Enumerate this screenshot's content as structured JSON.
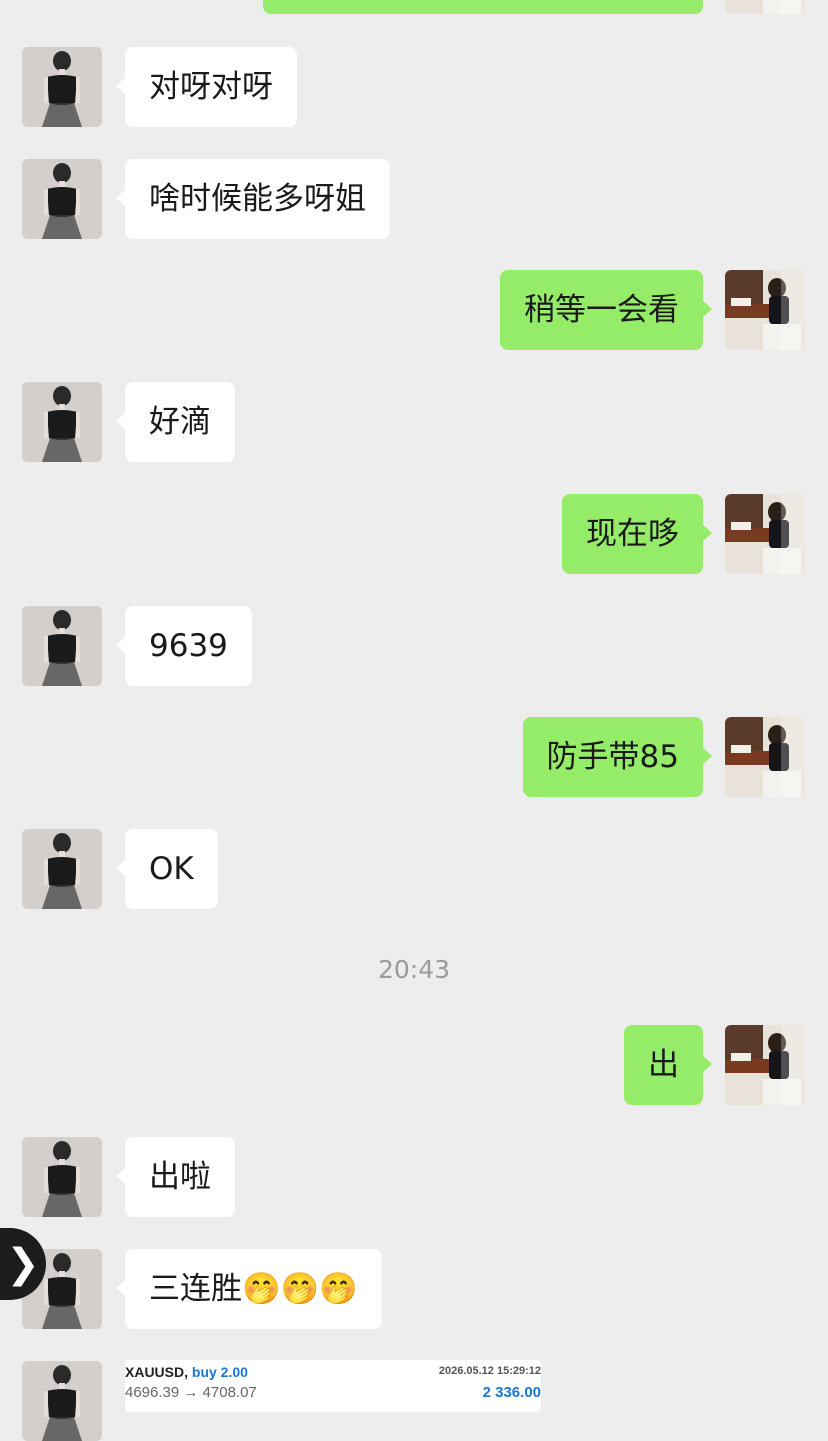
{
  "colors": {
    "background": "#ededed",
    "incoming_bubble": "#ffffff",
    "outgoing_bubble": "#95ec69",
    "timestamp": "#9a9a9a",
    "trade_accent": "#1976d2"
  },
  "messages": [
    {
      "sender": "contact",
      "text": "对呀对呀"
    },
    {
      "sender": "contact",
      "text": "啥时候能多呀姐"
    },
    {
      "sender": "me",
      "text": "稍等一会看"
    },
    {
      "sender": "contact",
      "text": "好滴"
    },
    {
      "sender": "me",
      "text": "现在哆"
    },
    {
      "sender": "contact",
      "text": "9639"
    },
    {
      "sender": "me",
      "text": "防手带85"
    },
    {
      "sender": "contact",
      "text": "OK"
    },
    {
      "sender": "me",
      "text": "出"
    },
    {
      "sender": "contact",
      "text": "出啦"
    },
    {
      "sender": "contact",
      "text": "三连胜🤭🤭🤭"
    }
  ],
  "timestamp": "20:43",
  "side_tab": {
    "icon": "chevron-right-icon",
    "glyph": "❯"
  },
  "trade_card": {
    "symbol": "XAUUSD,",
    "side": "buy 2.00",
    "datetime": "2026.05.12 15:29:12",
    "prices": "4696.39 → 4708.07",
    "profit": "2 336.00"
  },
  "avatars": {
    "contact": "contact-avatar",
    "me": "my-avatar"
  }
}
